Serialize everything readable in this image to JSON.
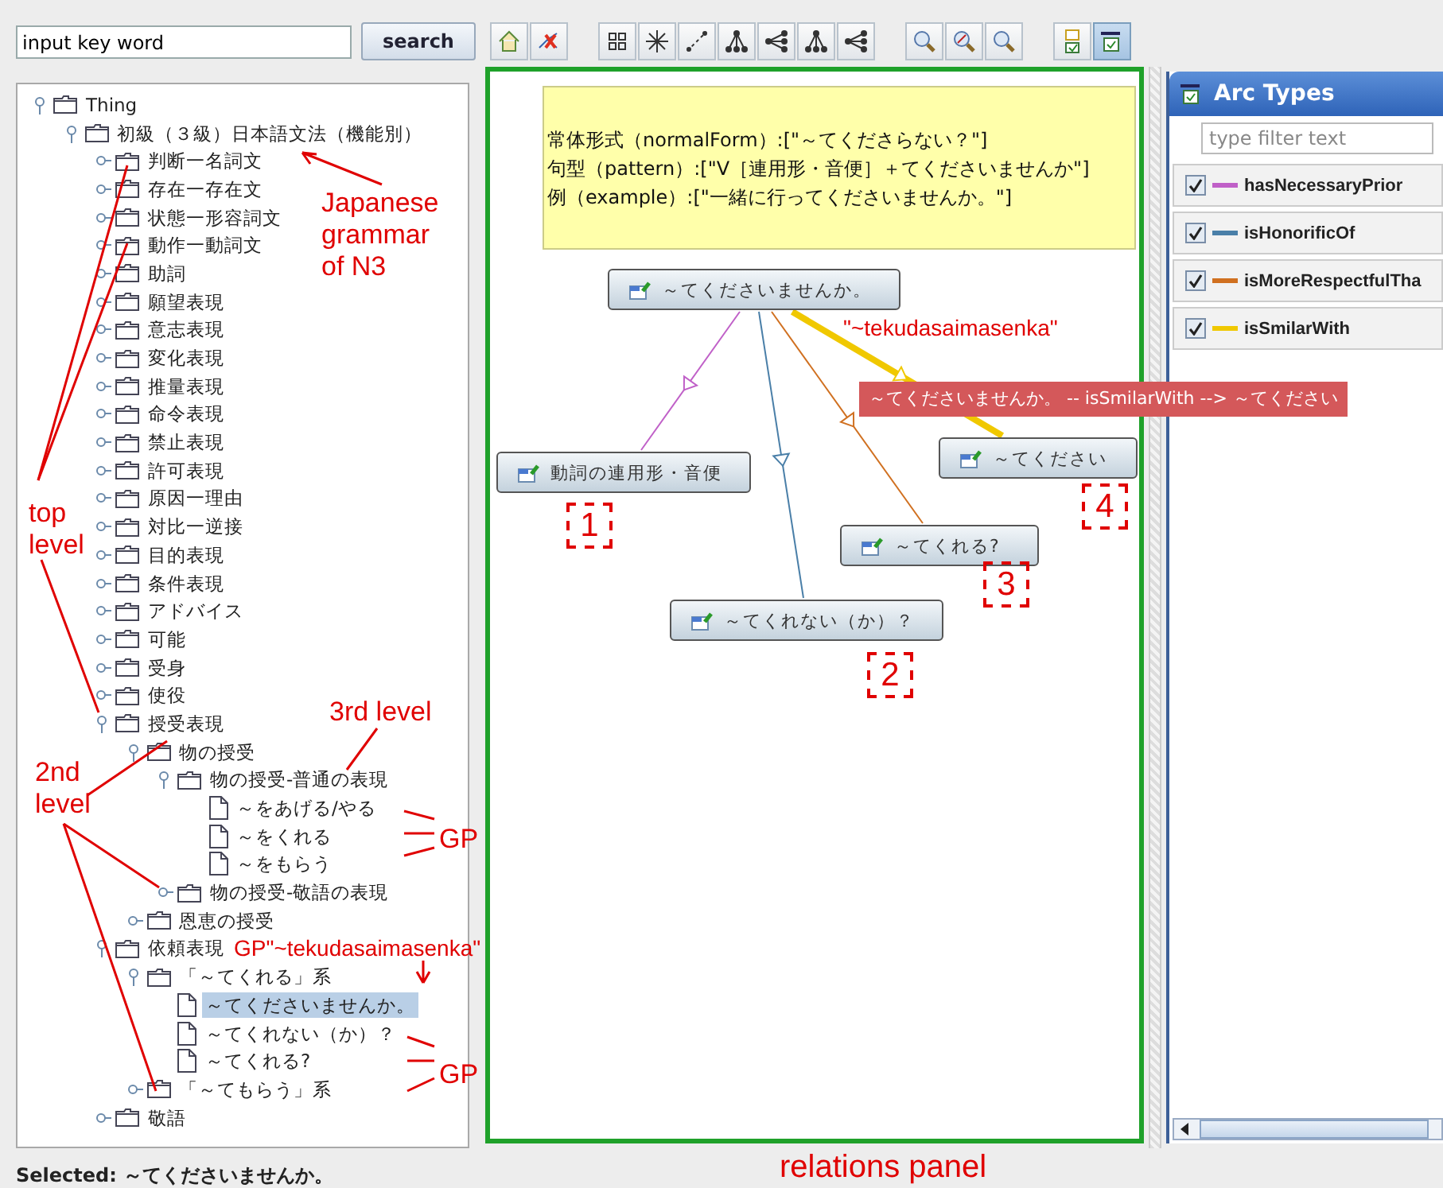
{
  "search": {
    "value": "input key word",
    "button": "search"
  },
  "toolbar": [
    {
      "kind": "home",
      "selected": false
    },
    {
      "kind": "unlink",
      "selected": false
    },
    {
      "kind": "grid",
      "selected": false
    },
    {
      "kind": "radial",
      "selected": false
    },
    {
      "kind": "line",
      "selected": false
    },
    {
      "kind": "tree-down",
      "selected": false
    },
    {
      "kind": "tree-left",
      "selected": false
    },
    {
      "kind": "tree-down",
      "selected": false
    },
    {
      "kind": "tree-left",
      "selected": false
    },
    {
      "kind": "zoom-in",
      "selected": false
    },
    {
      "kind": "zoom-fit",
      "selected": false
    },
    {
      "kind": "zoom-out",
      "selected": false
    },
    {
      "kind": "checklist",
      "selected": false
    },
    {
      "kind": "panel",
      "selected": true
    }
  ],
  "tree": {
    "label": "Thing",
    "kind": "folder",
    "expanded": true,
    "selected": false,
    "children": [
      {
        "label": "初級（３級）日本語文法（機能別）",
        "kind": "folder",
        "expanded": true,
        "selected": false,
        "children": [
          {
            "label": "判断一名詞文",
            "kind": "folder",
            "expanded": false,
            "selected": false
          },
          {
            "label": "存在一存在文",
            "kind": "folder",
            "expanded": false,
            "selected": false
          },
          {
            "label": "状態一形容詞文",
            "kind": "folder",
            "expanded": false,
            "selected": false
          },
          {
            "label": "動作一動詞文",
            "kind": "folder",
            "expanded": false,
            "selected": false
          },
          {
            "label": "助詞",
            "kind": "folder",
            "expanded": false,
            "selected": false
          },
          {
            "label": "願望表現",
            "kind": "folder",
            "expanded": false,
            "selected": false
          },
          {
            "label": "意志表現",
            "kind": "folder",
            "expanded": false,
            "selected": false
          },
          {
            "label": "変化表現",
            "kind": "folder",
            "expanded": false,
            "selected": false
          },
          {
            "label": "推量表現",
            "kind": "folder",
            "expanded": false,
            "selected": false
          },
          {
            "label": "命令表現",
            "kind": "folder",
            "expanded": false,
            "selected": false
          },
          {
            "label": "禁止表現",
            "kind": "folder",
            "expanded": false,
            "selected": false
          },
          {
            "label": "許可表現",
            "kind": "folder",
            "expanded": false,
            "selected": false
          },
          {
            "label": "原因一理由",
            "kind": "folder",
            "expanded": false,
            "selected": false
          },
          {
            "label": "対比一逆接",
            "kind": "folder",
            "expanded": false,
            "selected": false
          },
          {
            "label": "目的表現",
            "kind": "folder",
            "expanded": false,
            "selected": false
          },
          {
            "label": "条件表現",
            "kind": "folder",
            "expanded": false,
            "selected": false
          },
          {
            "label": "アドバイス",
            "kind": "folder",
            "expanded": false,
            "selected": false
          },
          {
            "label": "可能",
            "kind": "folder",
            "expanded": false,
            "selected": false
          },
          {
            "label": "受身",
            "kind": "folder",
            "expanded": false,
            "selected": false
          },
          {
            "label": "使役",
            "kind": "folder",
            "expanded": false,
            "selected": false
          },
          {
            "label": "授受表現",
            "kind": "folder",
            "expanded": true,
            "selected": false,
            "children": [
              {
                "label": "物の授受",
                "kind": "folder",
                "expanded": true,
                "selected": false,
                "children": [
                  {
                    "label": "物の授受-普通の表現",
                    "kind": "folder",
                    "expanded": true,
                    "selected": false,
                    "children": [
                      {
                        "label": "～をあげる/やる",
                        "kind": "leaf",
                        "selected": false
                      },
                      {
                        "label": "～をくれる",
                        "kind": "leaf",
                        "selected": false
                      },
                      {
                        "label": "～をもらう",
                        "kind": "leaf",
                        "selected": false
                      }
                    ]
                  },
                  {
                    "label": "物の授受-敬語の表現",
                    "kind": "folder",
                    "expanded": false,
                    "selected": false
                  }
                ]
              },
              {
                "label": "恩恵の授受",
                "kind": "folder",
                "expanded": false,
                "selected": false
              }
            ]
          },
          {
            "label": "依頼表現",
            "kind": "folder",
            "expanded": true,
            "selected": false,
            "children": [
              {
                "label": "「～てくれる」系",
                "kind": "folder",
                "expanded": true,
                "selected": false,
                "children": [
                  {
                    "label": "～てくださいませんか。",
                    "kind": "leaf",
                    "selected": true
                  },
                  {
                    "label": "～てくれない（か）？",
                    "kind": "leaf",
                    "selected": false
                  },
                  {
                    "label": "～てくれる?",
                    "kind": "leaf",
                    "selected": false
                  }
                ]
              },
              {
                "label": "「～てもらう」系",
                "kind": "folder",
                "expanded": false,
                "selected": false
              }
            ]
          },
          {
            "label": "敬語",
            "kind": "folder",
            "expanded": false,
            "selected": false
          }
        ]
      }
    ]
  },
  "status": "Selected: ～てくださいませんか。",
  "graph": {
    "note": [
      "常体形式（normalForm）:[\"～てくださらない？\"]",
      "句型（pattern）:[\"V［連用形・音便］＋てくださいませんか\"]",
      "例（example）:[\"一緒に行ってくださいませんか。\"]"
    ],
    "nodes": [
      {
        "label": "～てくださいませんか。"
      },
      {
        "label": "動詞の連用形・音便"
      },
      {
        "label": "～てくれない（か）？"
      },
      {
        "label": "～てくれる?"
      },
      {
        "label": "～てください"
      }
    ],
    "edge_label": "～てくださいませんか。 -- isSmilarWith --> ～てください"
  },
  "arc_types": {
    "title": "Arc Types",
    "filter_placeholder": "type filter text",
    "items": [
      {
        "name": "hasNecessaryPrior",
        "color": "#c060c8",
        "checked": true
      },
      {
        "name": "isHonorificOf",
        "color": "#4a7fa8",
        "checked": true
      },
      {
        "name": "isMoreRespectfulTha",
        "color": "#d07020",
        "checked": true
      },
      {
        "name": "isSmilarWith",
        "color": "#f0c800",
        "checked": true
      }
    ]
  },
  "annotations": [
    "Japanese grammar of N3",
    "top level",
    "3rd level",
    "2nd level",
    "GP",
    "GP\"~tekudasaimasenka\"",
    "GP",
    "\"~tekudasaimasenka\"",
    "relations panel"
  ],
  "markers": [
    "1",
    "2",
    "3",
    "4"
  ]
}
